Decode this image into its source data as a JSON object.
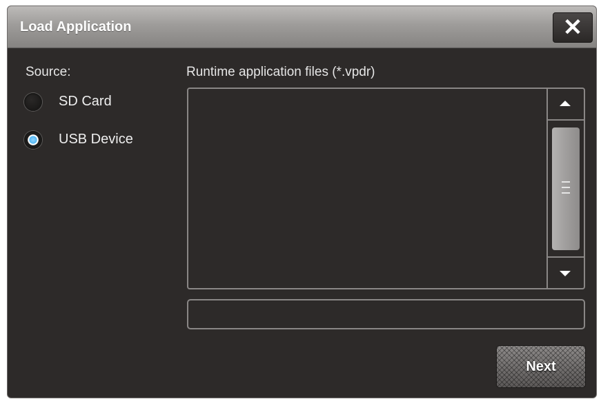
{
  "dialog": {
    "title": "Load Application",
    "close_icon": "close-icon",
    "close_glyph": "✕"
  },
  "source": {
    "label": "Source:",
    "options": [
      {
        "label": "SD Card",
        "selected": false
      },
      {
        "label": "USB Device",
        "selected": true
      }
    ]
  },
  "files": {
    "label": "Runtime application files (*.vpdr)",
    "items": [],
    "selected_path": ""
  },
  "scrollbar": {
    "up_icon": "arrow-up-icon",
    "down_icon": "arrow-down-icon",
    "grip_icon": "grip-icon"
  },
  "actions": {
    "next_label": "Next"
  },
  "colors": {
    "background": "#2d2a29",
    "titlebar": "#9e9c9a",
    "radio_selected": "#55b9f5",
    "border": "#8a8786"
  }
}
